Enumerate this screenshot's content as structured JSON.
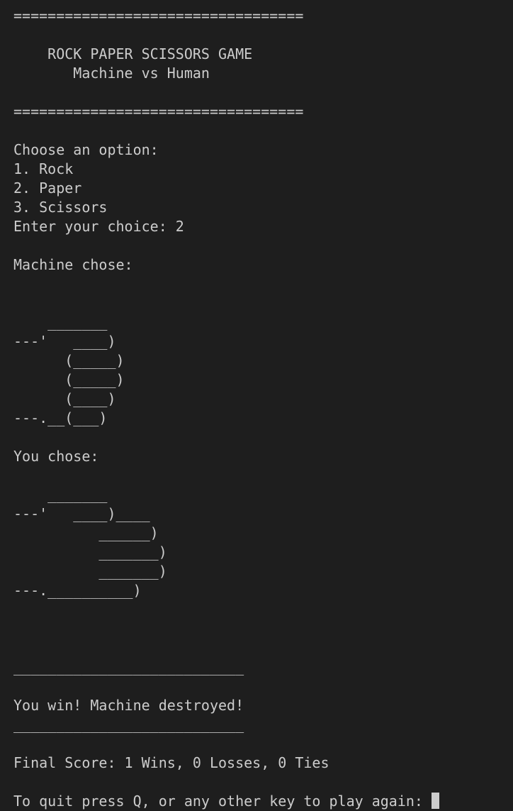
{
  "terminal": {
    "lines": [
      "==================================",
      "",
      "    ROCK PAPER SCISSORS GAME",
      "       Machine vs Human",
      "",
      "==================================",
      "",
      "Choose an option:",
      "1. Rock",
      "2. Paper",
      "3. Scissors",
      "Enter your choice: 2",
      "",
      "Machine chose:",
      "",
      "",
      "    _______",
      "---'   ____)",
      "      (_____)",
      "      (_____)",
      "      (____)",
      "---.__(___)",
      "",
      "You chose:",
      "",
      "    _______",
      "---'   ____)____",
      "          ______)",
      "          _______)",
      "          _______)",
      "---.__________)",
      "",
      "",
      "",
      "___________________________",
      "",
      "You win! Machine destroyed!",
      "___________________________",
      "",
      "Final Score: 1 Wins, 0 Losses, 0 Ties",
      ""
    ],
    "prompt": "To quit press Q, or any other key to play again: "
  },
  "colors": {
    "background": "#1e1e1e",
    "foreground": "#cccccc"
  }
}
